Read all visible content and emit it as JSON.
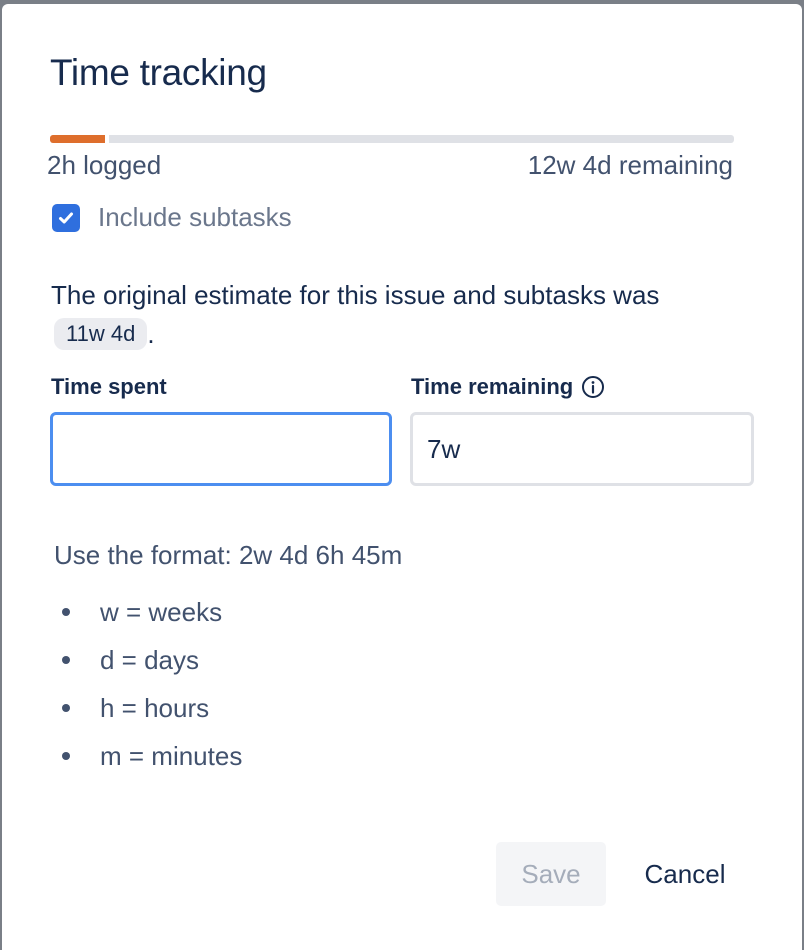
{
  "dialog": {
    "title": "Time tracking"
  },
  "progress": {
    "logged_fraction": 0.08,
    "logged_label": "2h logged",
    "remaining_label": "12w 4d remaining",
    "fill_color": "#de6e2c",
    "track_color": "#dfe1e6"
  },
  "subtasks": {
    "label": "Include subtasks",
    "checked": true,
    "icon": "check-icon"
  },
  "estimate": {
    "text": "The original estimate for this issue and subtasks was",
    "value": "11w 4d",
    "suffix": "."
  },
  "fields": {
    "time_spent": {
      "label": "Time spent",
      "value": ""
    },
    "time_remaining": {
      "label": "Time remaining",
      "value": "7w",
      "icon": "info-icon"
    }
  },
  "help": {
    "format": "Use the format: 2w 4d 6h 45m",
    "items": [
      "w = weeks",
      "d = days",
      "h = hours",
      "m = minutes"
    ]
  },
  "actions": {
    "save_label": "Save",
    "cancel_label": "Cancel"
  }
}
